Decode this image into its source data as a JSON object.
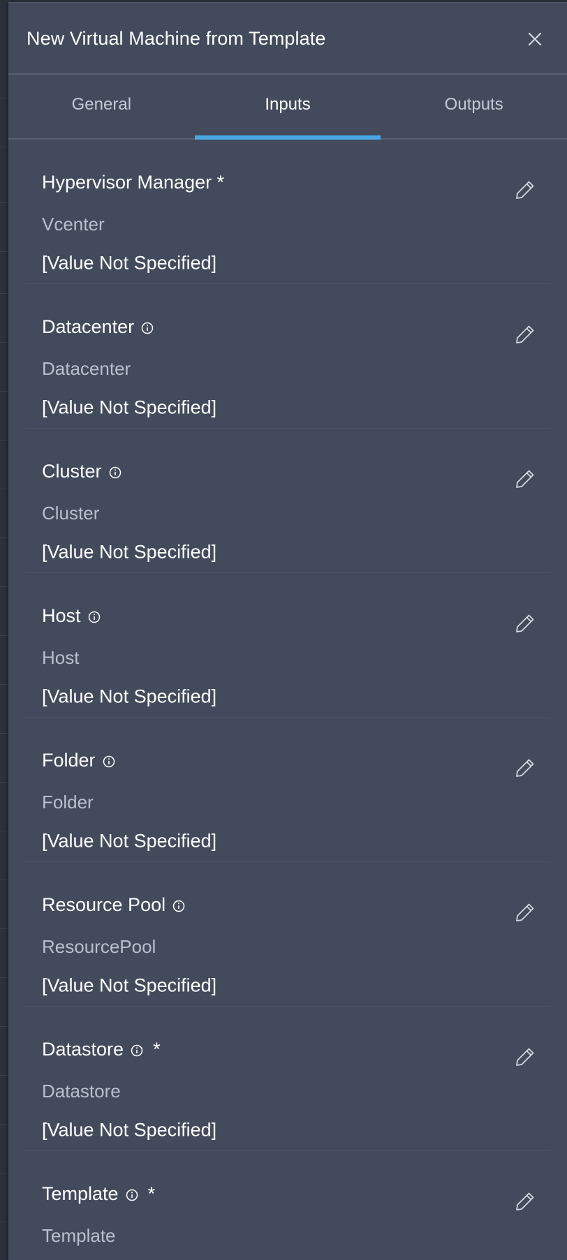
{
  "dialog": {
    "title": "New Virtual Machine from Template",
    "close_icon": "close-icon"
  },
  "tabs": [
    {
      "label": "General",
      "active": false
    },
    {
      "label": "Inputs",
      "active": true
    },
    {
      "label": "Outputs",
      "active": false
    }
  ],
  "colors": {
    "panel_bg": "#434a5c",
    "accent_tab_underline": "#49a8e6",
    "text_primary": "#ffffff",
    "text_secondary": "#b9bfcc"
  },
  "fields": [
    {
      "label": "Hypervisor Manager *",
      "type": "Vcenter",
      "value": "[Value Not Specified]",
      "info": false,
      "required_star": ""
    },
    {
      "label": "Datacenter",
      "type": "Datacenter",
      "value": "[Value Not Specified]",
      "info": true,
      "required_star": ""
    },
    {
      "label": "Cluster",
      "type": "Cluster",
      "value": "[Value Not Specified]",
      "info": true,
      "required_star": ""
    },
    {
      "label": "Host",
      "type": "Host",
      "value": "[Value Not Specified]",
      "info": true,
      "required_star": ""
    },
    {
      "label": "Folder",
      "type": "Folder",
      "value": "[Value Not Specified]",
      "info": true,
      "required_star": ""
    },
    {
      "label": "Resource Pool",
      "type": "ResourcePool",
      "value": "[Value Not Specified]",
      "info": true,
      "required_star": ""
    },
    {
      "label": "Datastore",
      "type": "Datastore",
      "value": "[Value Not Specified]",
      "info": true,
      "required_star": "*"
    },
    {
      "label": "Template",
      "type": "Template",
      "value": "",
      "info": true,
      "required_star": "*"
    }
  ]
}
